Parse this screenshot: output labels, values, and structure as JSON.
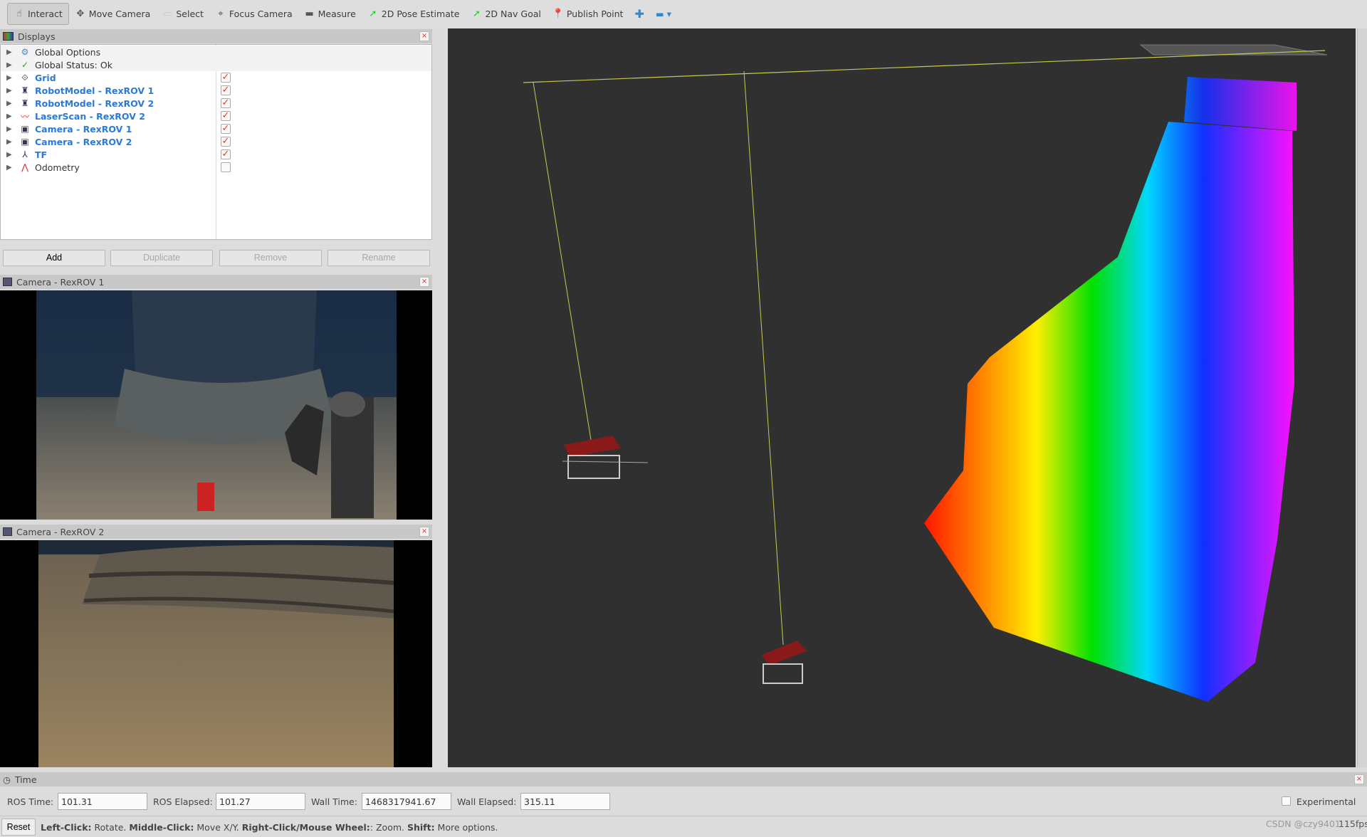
{
  "toolbar": {
    "tools": [
      {
        "label": "Interact",
        "icon": "hand-pointer-icon",
        "active": true
      },
      {
        "label": "Move Camera",
        "icon": "move-arrows-icon"
      },
      {
        "label": "Select",
        "icon": "select-rect-icon"
      },
      {
        "label": "Focus Camera",
        "icon": "crosshair-icon"
      },
      {
        "label": "Measure",
        "icon": "ruler-icon"
      },
      {
        "label": "2D Pose Estimate",
        "icon": "green-arrow-icon"
      },
      {
        "label": "2D Nav Goal",
        "icon": "green-arrow-icon"
      },
      {
        "label": "Publish Point",
        "icon": "map-pin-icon"
      }
    ],
    "add_icon": "plus-icon",
    "remove_icon": "minus-icon"
  },
  "displays": {
    "title": "Displays",
    "items": [
      {
        "label": "Global Options",
        "icon": "gear-icon",
        "checkbox": null
      },
      {
        "label": "Global Status: Ok",
        "icon": "check-icon",
        "checkbox": null
      },
      {
        "label": "Grid",
        "icon": "grid-icon",
        "checkbox": true,
        "enabled": true
      },
      {
        "label": "RobotModel - RexROV 1",
        "icon": "robot-icon",
        "checkbox": true,
        "enabled": true
      },
      {
        "label": "RobotModel - RexROV 2",
        "icon": "robot-icon",
        "checkbox": true,
        "enabled": true
      },
      {
        "label": "LaserScan - RexROV 2",
        "icon": "laser-icon",
        "checkbox": true,
        "enabled": true
      },
      {
        "label": "Camera - RexROV 1",
        "icon": "camera-image-icon",
        "checkbox": true,
        "enabled": true
      },
      {
        "label": "Camera - RexROV 2",
        "icon": "camera-image-icon",
        "checkbox": true,
        "enabled": true
      },
      {
        "label": "TF",
        "icon": "tf-axes-icon",
        "checkbox": true,
        "enabled": true
      },
      {
        "label": "Odometry",
        "icon": "odometry-icon",
        "checkbox": false,
        "enabled": false
      }
    ],
    "buttons": {
      "add": "Add",
      "duplicate": "Duplicate",
      "remove": "Remove",
      "rename": "Rename"
    }
  },
  "camera1": {
    "title": "Camera - RexROV 1"
  },
  "camera2": {
    "title": "Camera - RexROV 2"
  },
  "time": {
    "title": "Time",
    "ros_time_label": "ROS Time:",
    "ros_time": "101.31",
    "ros_elapsed_label": "ROS Elapsed:",
    "ros_elapsed": "101.27",
    "wall_time_label": "Wall Time:",
    "wall_time": "1468317941.67",
    "wall_elapsed_label": "Wall Elapsed:",
    "wall_elapsed": "315.11",
    "experimental_label": "Experimental",
    "experimental": false
  },
  "status": {
    "reset": "Reset",
    "k1": "Left-Click:",
    "v1": " Rotate. ",
    "k2": "Middle-Click:",
    "v2": " Move X/Y. ",
    "k3": "Right-Click/Mouse Wheel:",
    "v3": ": Zoom. ",
    "k4": "Shift:",
    "v4": " More options.",
    "fps": "115fps",
    "watermark": "CSDN @czy9401"
  },
  "colors": {
    "viewport_bg": "#303030",
    "link_blue": "#2a7ad8",
    "check_red": "#e03c2c"
  }
}
